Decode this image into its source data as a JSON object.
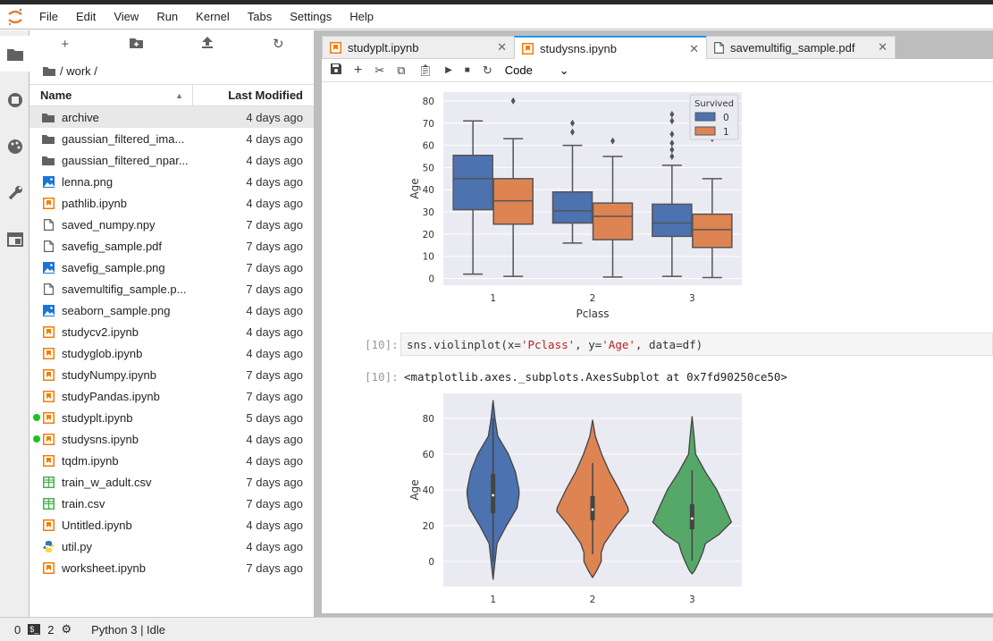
{
  "menu": [
    "File",
    "Edit",
    "View",
    "Run",
    "Kernel",
    "Tabs",
    "Settings",
    "Help"
  ],
  "breadcrumb": "/ work /",
  "file_header": {
    "name": "Name",
    "modified": "Last Modified"
  },
  "files": [
    {
      "name": "archive",
      "modified": "4 days ago",
      "type": "folder",
      "selected": true
    },
    {
      "name": "gaussian_filtered_ima...",
      "modified": "4 days ago",
      "type": "folder"
    },
    {
      "name": "gaussian_filtered_npar...",
      "modified": "4 days ago",
      "type": "folder"
    },
    {
      "name": "lenna.png",
      "modified": "4 days ago",
      "type": "image"
    },
    {
      "name": "pathlib.ipynb",
      "modified": "4 days ago",
      "type": "notebook"
    },
    {
      "name": "saved_numpy.npy",
      "modified": "7 days ago",
      "type": "file"
    },
    {
      "name": "savefig_sample.pdf",
      "modified": "7 days ago",
      "type": "file"
    },
    {
      "name": "savefig_sample.png",
      "modified": "7 days ago",
      "type": "image"
    },
    {
      "name": "savemultifig_sample.p...",
      "modified": "7 days ago",
      "type": "file"
    },
    {
      "name": "seaborn_sample.png",
      "modified": "4 days ago",
      "type": "image"
    },
    {
      "name": "studycv2.ipynb",
      "modified": "4 days ago",
      "type": "notebook"
    },
    {
      "name": "studyglob.ipynb",
      "modified": "4 days ago",
      "type": "notebook"
    },
    {
      "name": "studyNumpy.ipynb",
      "modified": "7 days ago",
      "type": "notebook"
    },
    {
      "name": "studyPandas.ipynb",
      "modified": "7 days ago",
      "type": "notebook"
    },
    {
      "name": "studyplt.ipynb",
      "modified": "5 days ago",
      "type": "notebook",
      "running": true
    },
    {
      "name": "studysns.ipynb",
      "modified": "4 days ago",
      "type": "notebook",
      "running": true
    },
    {
      "name": "tqdm.ipynb",
      "modified": "4 days ago",
      "type": "notebook"
    },
    {
      "name": "train_w_adult.csv",
      "modified": "7 days ago",
      "type": "csv"
    },
    {
      "name": "train.csv",
      "modified": "7 days ago",
      "type": "csv"
    },
    {
      "name": "Untitled.ipynb",
      "modified": "4 days ago",
      "type": "notebook"
    },
    {
      "name": "util.py",
      "modified": "4 days ago",
      "type": "python"
    },
    {
      "name": "worksheet.ipynb",
      "modified": "7 days ago",
      "type": "notebook"
    }
  ],
  "tabs": [
    {
      "label": "studyplt.ipynb",
      "icon": "notebook"
    },
    {
      "label": "studysns.ipynb",
      "icon": "notebook",
      "active": true
    },
    {
      "label": "savemultifig_sample.pdf",
      "icon": "file"
    }
  ],
  "toolbar": {
    "cell_type": "Code"
  },
  "cell": {
    "in_prompt": "[10]:",
    "out_prompt": "[10]:",
    "code_fn": "sns.",
    "code_call": "violinplot",
    "code_args1": "(x=",
    "code_s1": "'Pclass'",
    "code_args2": ", y=",
    "code_s2": "'Age'",
    "code_args3": ", data=df)",
    "output": "<matplotlib.axes._subplots.AxesSubplot at 0x7fd90250ce50>"
  },
  "status": {
    "terminals": "0",
    "kernels": "2",
    "kernel": "Python 3 | Idle"
  },
  "colors": {
    "blue": "#4c72b0",
    "orange": "#dd8452",
    "green": "#55a868",
    "axes_bg": "#eaeaf2",
    "accent": "#2196f3",
    "running": "#1ec31e"
  },
  "chart_data": [
    {
      "type": "box",
      "xlabel": "Pclass",
      "ylabel": "Age",
      "categories": [
        "1",
        "2",
        "3"
      ],
      "yticks": [
        0,
        10,
        20,
        30,
        40,
        50,
        60,
        70,
        80
      ],
      "ylim": [
        -3,
        84
      ],
      "grid": true,
      "legend": {
        "title": "Survived",
        "entries": [
          "0",
          "1"
        ],
        "placement": "top-right"
      },
      "series": [
        {
          "name": "0",
          "color": "#4c72b0",
          "boxes": [
            {
              "whislo": 2,
              "q1": 31,
              "med": 45,
              "q3": 55.5,
              "whishi": 71,
              "fliers": []
            },
            {
              "whislo": 16,
              "q1": 25,
              "med": 30.5,
              "q3": 39,
              "whishi": 60,
              "fliers": [
                66,
                70
              ]
            },
            {
              "whislo": 1,
              "q1": 19,
              "med": 25,
              "q3": 33.5,
              "whishi": 51,
              "fliers": [
                55,
                58,
                61,
                65,
                71,
                74
              ]
            }
          ]
        },
        {
          "name": "1",
          "color": "#dd8452",
          "boxes": [
            {
              "whislo": 1,
              "q1": 24.5,
              "med": 35,
              "q3": 45,
              "whishi": 63,
              "fliers": [
                80
              ]
            },
            {
              "whislo": 0.7,
              "q1": 17.5,
              "med": 28,
              "q3": 34,
              "whishi": 55,
              "fliers": [
                62
              ]
            },
            {
              "whislo": 0.4,
              "q1": 14,
              "med": 22,
              "q3": 29,
              "whishi": 45,
              "fliers": [
                63
              ]
            }
          ]
        }
      ]
    },
    {
      "type": "violin",
      "xlabel": "Pclass",
      "ylabel": "Age",
      "categories": [
        "1",
        "2",
        "3"
      ],
      "yticks": [
        0,
        20,
        40,
        60,
        80
      ],
      "ylim": [
        -14,
        94
      ],
      "grid": true,
      "violins": [
        {
          "color": "#4c72b0",
          "q1": 27,
          "med": 37,
          "q3": 49,
          "whislo": 0,
          "whishi": 80,
          "density": [
            [
              -10,
              0
            ],
            [
              0,
              0.05
            ],
            [
              10,
              0.1
            ],
            [
              20,
              0.34
            ],
            [
              30,
              0.61
            ],
            [
              37,
              0.66
            ],
            [
              40,
              0.66
            ],
            [
              50,
              0.57
            ],
            [
              60,
              0.39
            ],
            [
              70,
              0.12
            ],
            [
              80,
              0.05
            ],
            [
              90,
              0
            ]
          ]
        },
        {
          "color": "#dd8452",
          "q1": 23,
          "med": 29,
          "q3": 36.5,
          "whislo": 4,
          "whishi": 55,
          "density": [
            [
              -9,
              0
            ],
            [
              -5,
              0.11
            ],
            [
              0,
              0.22
            ],
            [
              5,
              0.22
            ],
            [
              10,
              0.3
            ],
            [
              20,
              0.61
            ],
            [
              28,
              0.91
            ],
            [
              30,
              0.9
            ],
            [
              40,
              0.68
            ],
            [
              50,
              0.43
            ],
            [
              60,
              0.23
            ],
            [
              70,
              0.07
            ],
            [
              79,
              0
            ]
          ]
        },
        {
          "color": "#55a868",
          "q1": 18,
          "med": 24,
          "q3": 32,
          "whislo": 0.4,
          "whishi": 51,
          "density": [
            [
              -7,
              0
            ],
            [
              -5,
              0.07
            ],
            [
              0,
              0.18
            ],
            [
              5,
              0.27
            ],
            [
              10,
              0.34
            ],
            [
              15,
              0.68
            ],
            [
              22,
              1.0
            ],
            [
              30,
              0.84
            ],
            [
              40,
              0.63
            ],
            [
              50,
              0.34
            ],
            [
              60,
              0.09
            ],
            [
              70,
              0.05
            ],
            [
              81,
              0
            ]
          ]
        }
      ]
    }
  ]
}
